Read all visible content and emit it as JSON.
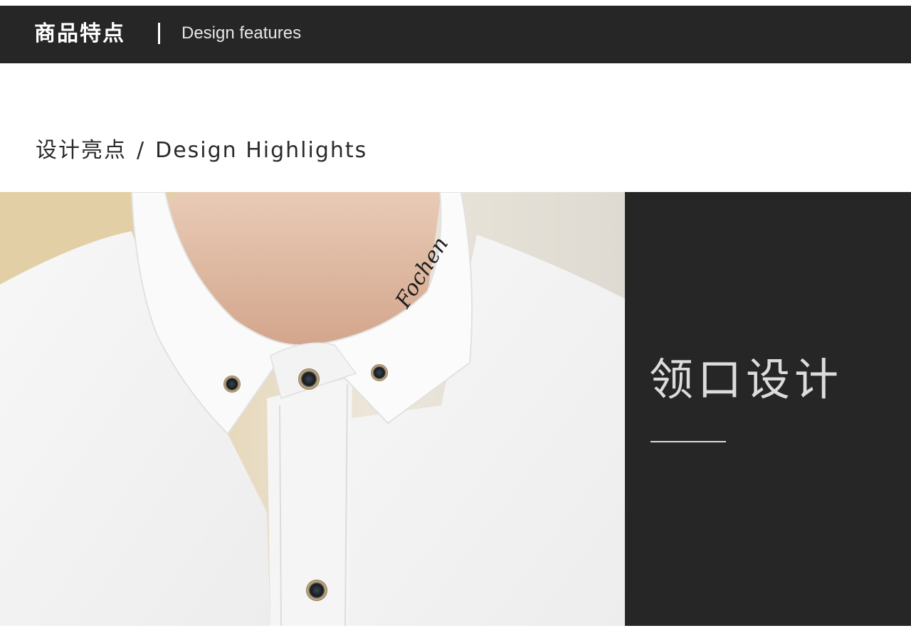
{
  "header": {
    "title_cn": "商品特点",
    "title_en": "Design features"
  },
  "section": {
    "title_cn": "设计亮点",
    "separator": "/",
    "title_en": "Design Highlights"
  },
  "photo": {
    "embroidery_text": "Fochen"
  },
  "panel": {
    "title": "领口设计"
  },
  "colors": {
    "dark": "#262626",
    "light_text": "#dcdcdc",
    "shirt": "#f4f4f4"
  }
}
